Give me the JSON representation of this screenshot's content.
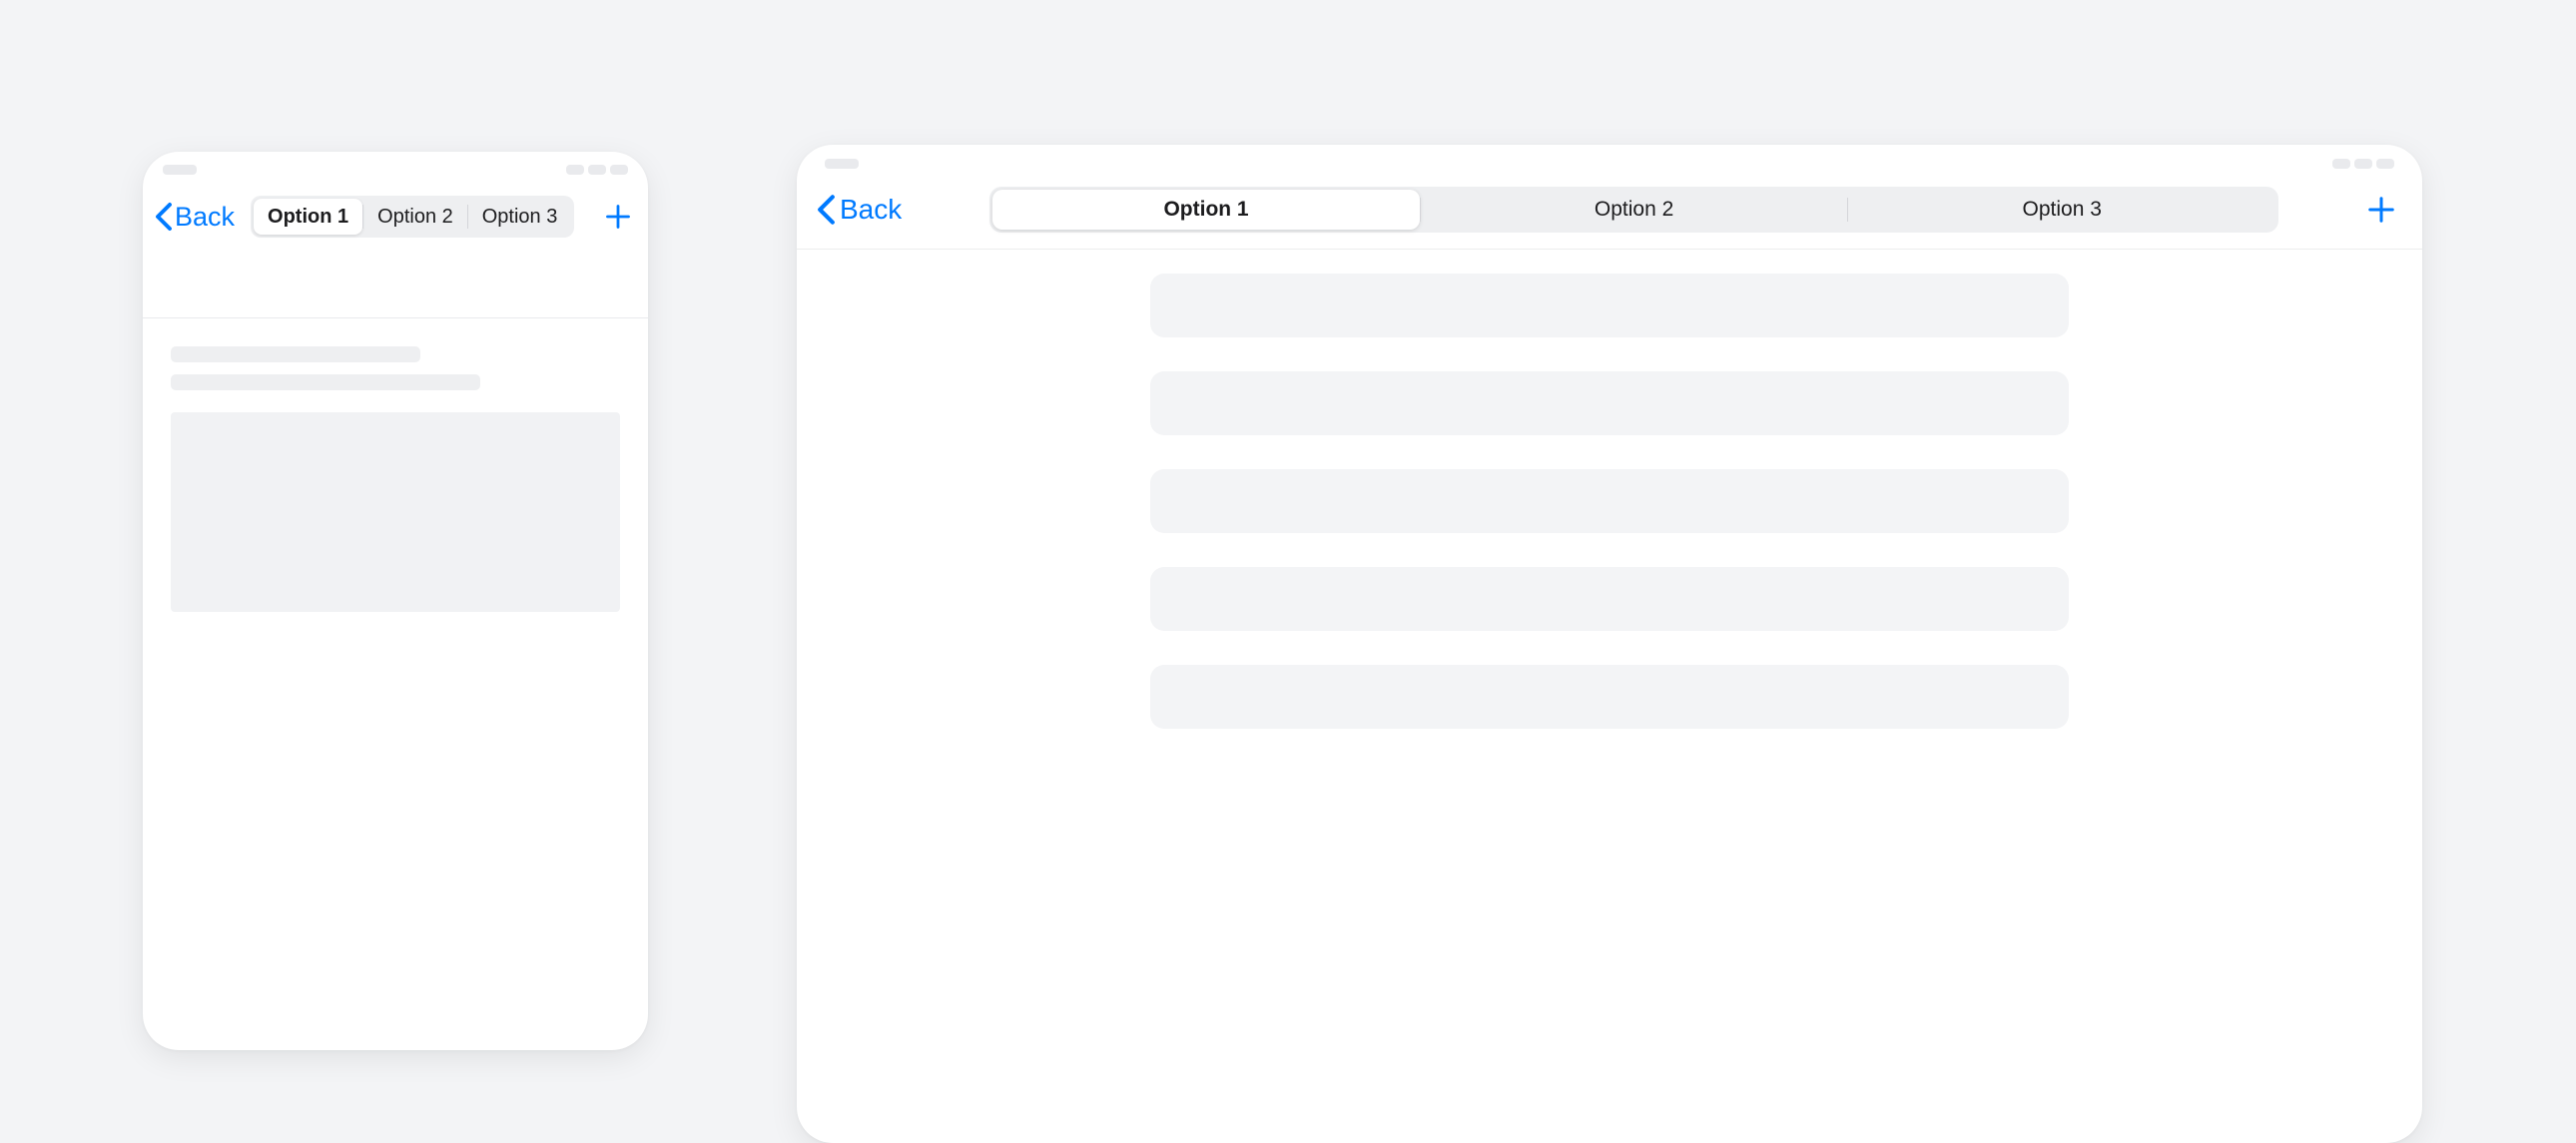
{
  "phone": {
    "back_label": "Back",
    "segments": [
      "Option 1",
      "Option 2",
      "Option 3"
    ],
    "selected_index": 0
  },
  "tablet": {
    "back_label": "Back",
    "segments": [
      "Option 1",
      "Option 2",
      "Option 3"
    ],
    "selected_index": 0
  }
}
